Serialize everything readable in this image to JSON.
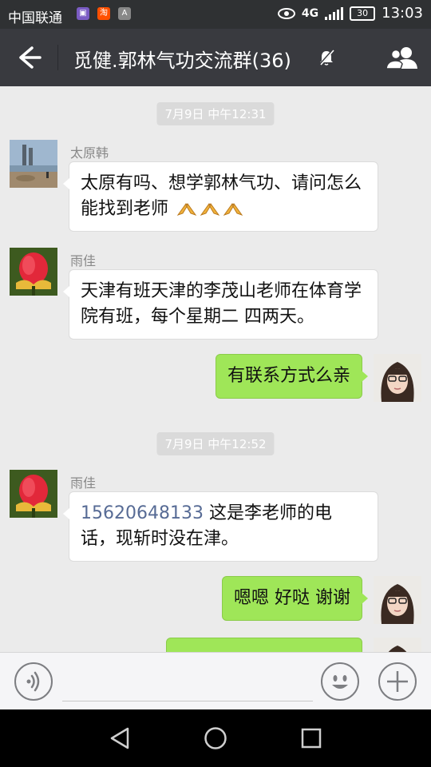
{
  "status_bar": {
    "carrier": "中国联通",
    "app_icons": [
      "gallery-icon",
      "taobao-icon",
      "keyboard-icon"
    ],
    "taobao_label": "淘",
    "network": "4G",
    "network_small": "4G",
    "battery": "30",
    "time": "13:03"
  },
  "header": {
    "title": "觅健.郭林气功交流群(36)",
    "back_icon": "back-arrow-icon",
    "mute_icon": "mute-bell-icon",
    "members_icon": "group-members-icon"
  },
  "messages": [
    {
      "type": "timestamp",
      "text": "7月9日 中午12:31"
    },
    {
      "type": "incoming",
      "sender": "太原韩",
      "text": "太原有吗、想学郭林气功、请问怎么能找到老师",
      "emoji": [
        "pray",
        "pray",
        "pray"
      ]
    },
    {
      "type": "incoming",
      "sender": "雨佳",
      "text": "天津有班天津的李茂山老师在体育学院有班，每个星期二 四两天。"
    },
    {
      "type": "outgoing",
      "text": "有联系方式么亲"
    },
    {
      "type": "timestamp",
      "text": "7月9日 中午12:52"
    },
    {
      "type": "incoming",
      "sender": "雨佳",
      "phone": "15620648133",
      "text": " 这是李老师的电话，现斩时没在津。"
    },
    {
      "type": "outgoing",
      "text": "嗯嗯 好哒 谢谢"
    }
  ],
  "input_bar": {
    "placeholder": "",
    "voice_icon": "voice-input-icon",
    "emoji_icon": "emoji-icon",
    "plus_icon": "plus-icon"
  },
  "colors": {
    "status_bar_bg": "#2f3133",
    "header_bg": "#393a3f",
    "chat_bg": "#ebebeb",
    "outgoing_bubble": "#9fe658",
    "incoming_bubble": "#ffffff",
    "phone_link": "#576b95"
  }
}
